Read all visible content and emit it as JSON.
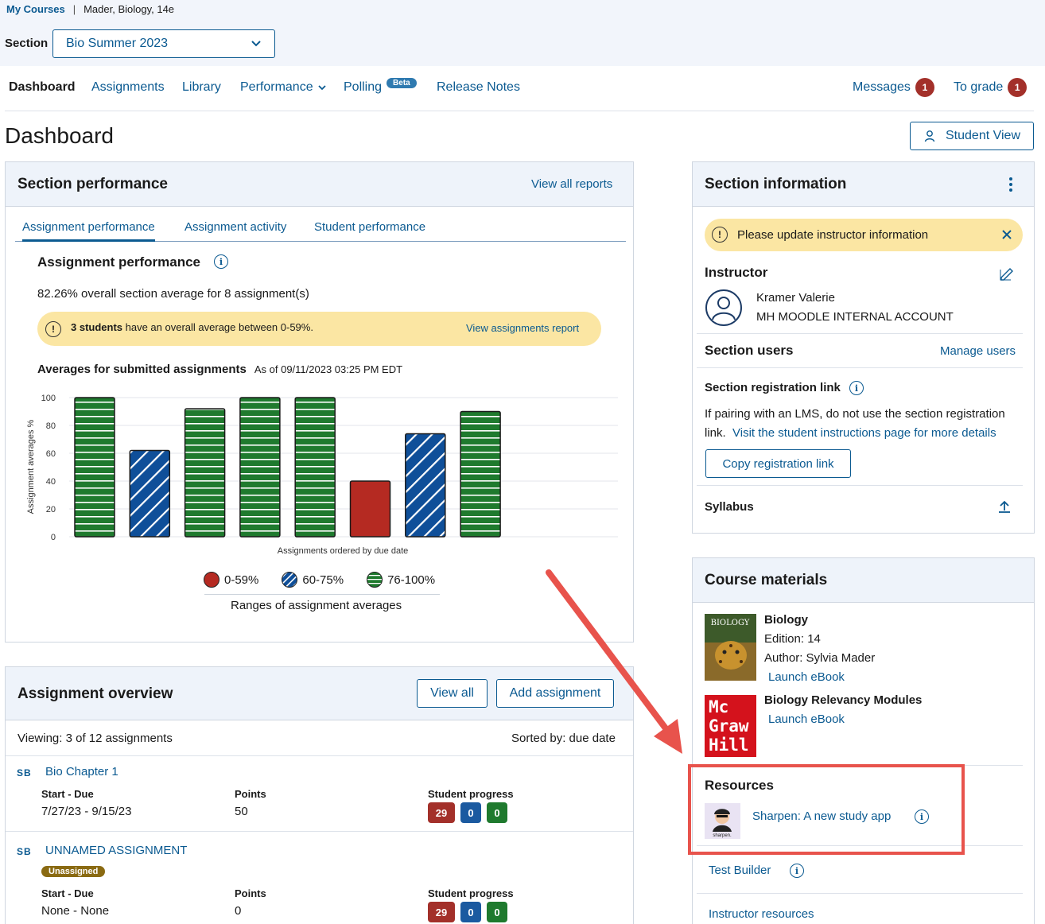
{
  "breadcrumb": {
    "my_courses": "My Courses",
    "separator": "|",
    "course": "Mader, Biology, 14e"
  },
  "section_select": {
    "label": "Section",
    "value": "Bio Summer 2023"
  },
  "nav": {
    "dashboard": "Dashboard",
    "assignments": "Assignments",
    "library": "Library",
    "performance": "Performance",
    "polling": "Polling",
    "polling_badge": "Beta",
    "release_notes": "Release Notes",
    "messages": "Messages",
    "messages_count": "1",
    "to_grade": "To grade",
    "to_grade_count": "1"
  },
  "page_title": "Dashboard",
  "student_view_button": "Student View",
  "section_performance": {
    "title": "Section performance",
    "view_all_reports": "View all reports",
    "tabs": [
      "Assignment performance",
      "Assignment activity",
      "Student performance"
    ],
    "subtitle": "Assignment performance",
    "average_text": "82.26% overall section average for 8 assignment(s)",
    "alert_bold": "3 students",
    "alert_text": " have an overall average between 0-59%.",
    "alert_link": "View assignments report",
    "averages_title": "Averages for submitted assignments",
    "averages_asof": "As of 09/11/2023 03:25 PM EDT",
    "legend_caption": "Ranges of assignment averages"
  },
  "chart_data": {
    "type": "bar",
    "values": [
      100,
      62,
      92,
      100,
      100,
      40,
      74,
      90
    ],
    "range_category": [
      "76-100%",
      "60-75%",
      "76-100%",
      "76-100%",
      "76-100%",
      "0-59%",
      "60-75%",
      "76-100%"
    ],
    "xlabel": "Assignments ordered by due date",
    "ylabel": "Assignment averages %",
    "ylim": [
      0,
      100
    ],
    "yticks": [
      0,
      20,
      40,
      60,
      80,
      100
    ],
    "grid": true,
    "legend": [
      {
        "name": "0-59%",
        "color": "#b52a22"
      },
      {
        "name": "60-75%",
        "color": "#0f4f99"
      },
      {
        "name": "76-100%",
        "color": "#1f7a2e"
      }
    ]
  },
  "assignment_overview": {
    "title": "Assignment overview",
    "view_all": "View all",
    "add_assignment": "Add assignment",
    "viewing": "Viewing: 3 of 12 assignments",
    "sorted": "Sorted by: due date",
    "col_start_due": "Start - Due",
    "col_points": "Points",
    "col_progress": "Student progress",
    "items": [
      {
        "icon": "SB",
        "name": "Bio Chapter 1",
        "dates": "7/27/23 - 9/15/23",
        "points": "50",
        "status": "",
        "progress": [
          "29",
          "0",
          "0"
        ]
      },
      {
        "icon": "SB",
        "name": "UNNAMED ASSIGNMENT",
        "dates": "None - None",
        "points": "0",
        "status": "Unassigned",
        "progress": [
          "29",
          "0",
          "0"
        ]
      }
    ]
  },
  "section_information": {
    "title": "Section information",
    "alert": "Please update instructor information",
    "instructor_label": "Instructor",
    "instructor_name": "Kramer Valerie",
    "instructor_account": "MH MOODLE INTERNAL ACCOUNT",
    "section_users": "Section users",
    "manage_users": "Manage users",
    "registration_title": "Section registration link",
    "registration_text": "If pairing with an LMS, do not use the section registration link.",
    "registration_link": "Visit the student instructions page for more details",
    "copy_button": "Copy registration link",
    "syllabus": "Syllabus"
  },
  "course_materials": {
    "title": "Course materials",
    "book1": {
      "title": "Biology",
      "edition": "Edition: 14",
      "author": "Author: Sylvia Mader",
      "launch": "Launch eBook",
      "cover_text": "BIOLOGY"
    },
    "book2": {
      "title": "Biology Relevancy Modules",
      "launch": "Launch eBook",
      "logo_lines": [
        "Mc",
        "Graw",
        "Hill"
      ]
    },
    "resources_title": "Resources",
    "sharpen": "Sharpen: A new study app",
    "sharpen_logo_text": "sharpen.",
    "test_builder": "Test Builder",
    "instructor_resources": "Instructor resources"
  },
  "colors": {
    "link": "#0b5a91",
    "alert_bg": "#fbe6a3",
    "header_bg": "#eef3fa",
    "annotation": "#e8534c"
  }
}
